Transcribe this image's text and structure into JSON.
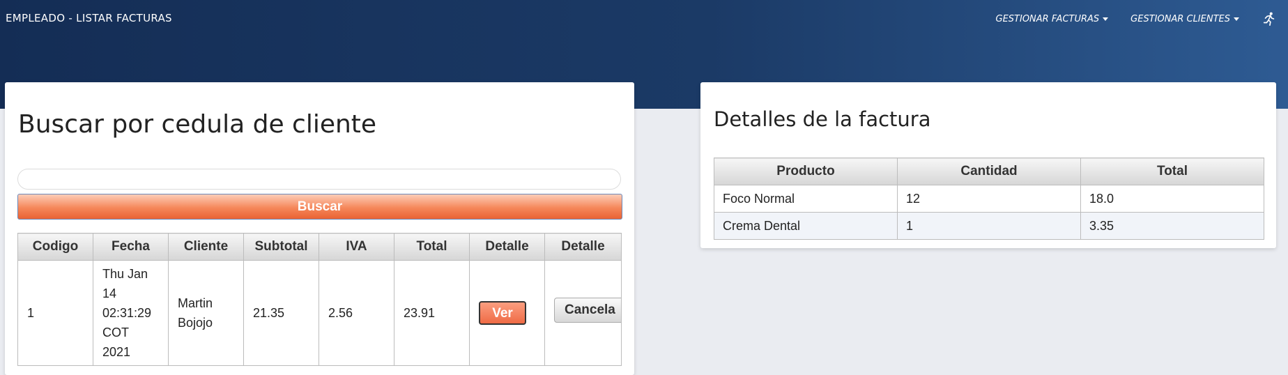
{
  "header": {
    "brand": "EMPLEADO - LISTAR FACTURAS",
    "nav": [
      {
        "label": "GESTIONAR FACTURAS"
      },
      {
        "label": "GESTIONAR CLIENTES"
      }
    ],
    "logout_icon": "running-person-icon"
  },
  "search_panel": {
    "title": "Buscar por cedula de cliente",
    "input_value": "",
    "button_label": "Buscar",
    "table": {
      "headers": [
        "Codigo",
        "Fecha",
        "Cliente",
        "Subtotal",
        "IVA",
        "Total",
        "Detalle",
        "Detalle"
      ],
      "rows": [
        {
          "codigo": "1",
          "fecha_lines": [
            "Thu Jan",
            "14",
            "02:31:29",
            "COT",
            "2021"
          ],
          "cliente_lines": [
            "Martin",
            "Bojojo"
          ],
          "subtotal": "21.35",
          "iva": "2.56",
          "total": "23.91",
          "ver_label": "Ver",
          "cancel_label": "Cancela"
        }
      ]
    }
  },
  "details_panel": {
    "title": "Detalles de la factura",
    "table": {
      "headers": [
        "Producto",
        "Cantidad",
        "Total"
      ],
      "rows": [
        {
          "producto": "Foco Normal",
          "cantidad": "12",
          "total": "18.0"
        },
        {
          "producto": "Crema Dental",
          "cantidad": "1",
          "total": "3.35"
        }
      ]
    }
  },
  "colors": {
    "header_dark": "#142d55",
    "header_light": "#2e5b93",
    "accent_orange": "#ef6b45",
    "page_bg": "#eaecf1"
  }
}
